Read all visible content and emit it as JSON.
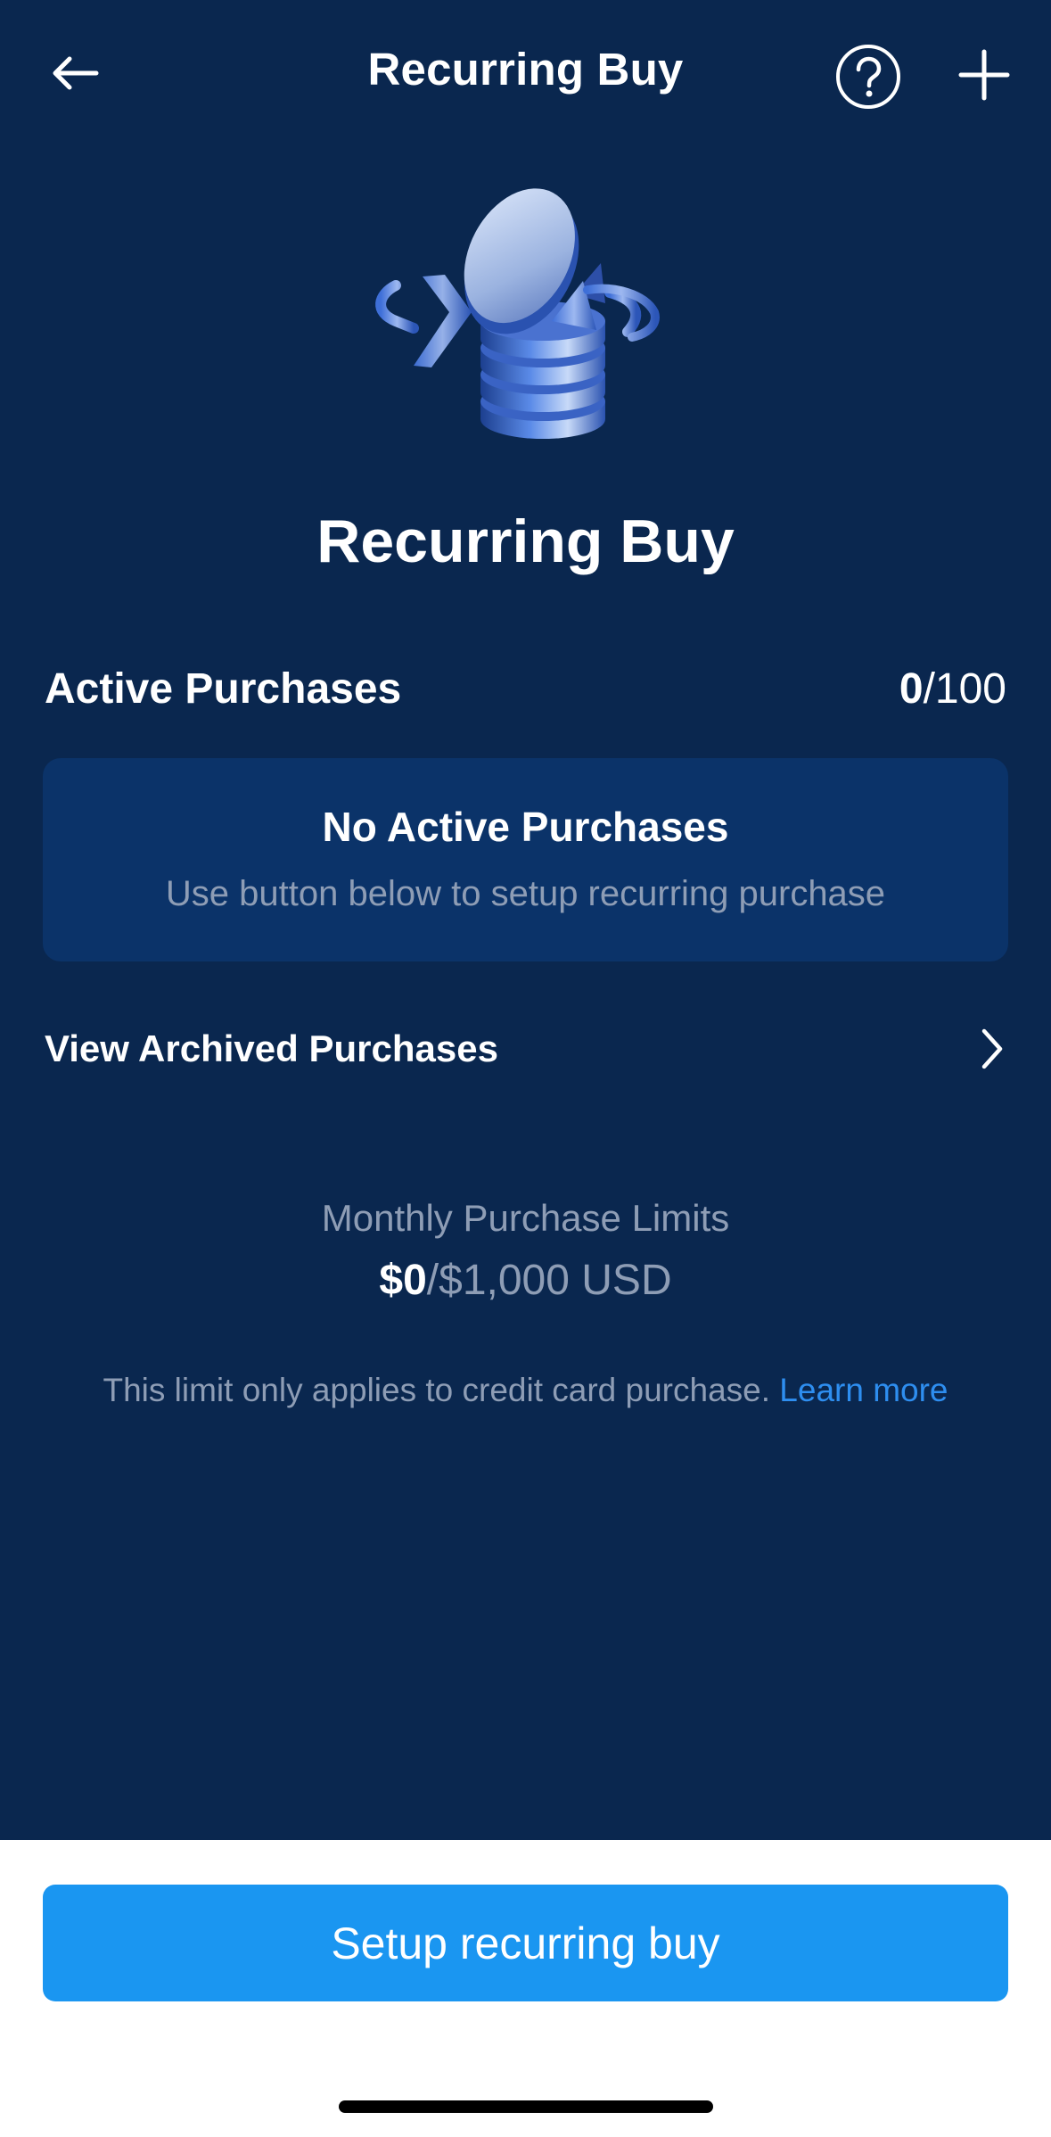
{
  "header": {
    "title": "Recurring Buy",
    "back_icon": "arrow-left-icon",
    "help_icon": "question-circle-icon",
    "add_icon": "plus-icon"
  },
  "hero": {
    "image": "coin-stack-with-circular-arrows-illustration",
    "title": "Recurring Buy"
  },
  "active_purchases": {
    "label": "Active Purchases",
    "count_current": "0",
    "count_max": "/100"
  },
  "empty_state": {
    "title": "No Active Purchases",
    "subtitle": "Use button below to setup recurring purchase"
  },
  "archived": {
    "label": "View Archived Purchases",
    "icon": "chevron-right-icon"
  },
  "limits": {
    "label": "Monthly Purchase Limits",
    "used": "$0",
    "total": "/$1,000 USD",
    "note": "This limit only applies to credit card purchase.",
    "learn_more": "Learn more"
  },
  "cta": {
    "label": "Setup recurring buy"
  },
  "colors": {
    "background": "#0A274F",
    "card": "#0B3369",
    "accent": "#1A96F1",
    "link": "#2E8EF0",
    "muted_text": "#8E9DB5"
  }
}
